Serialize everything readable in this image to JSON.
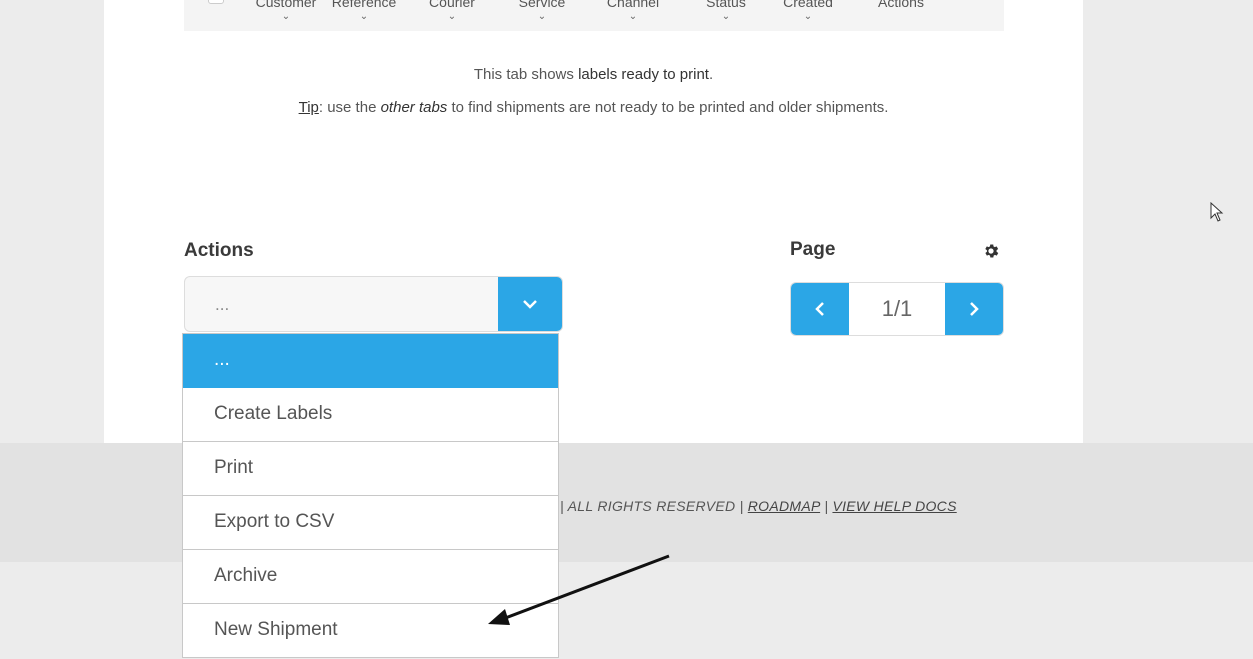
{
  "table": {
    "columns": [
      "Customer",
      "Reference",
      "Courier",
      "Service",
      "Channel",
      "Status",
      "Created",
      "Actions"
    ]
  },
  "tip": {
    "line1_pre": "This tab shows ",
    "line1_bold": "labels ready to print",
    "line1_post": ".",
    "tip_label": "Tip",
    "line2_pre": ": use the ",
    "line2_italic": "other tabs",
    "line2_post": " to find shipments are not ready to be printed and older shipments."
  },
  "actions": {
    "title": "Actions",
    "selected_value": "...",
    "options": [
      "...",
      "Create Labels",
      "Print",
      "Export to CSV",
      "Archive",
      "New Shipment"
    ]
  },
  "pager": {
    "title": "Page",
    "label": "1/1"
  },
  "footer": {
    "rights": "| ALL RIGHTS RESERVED |",
    "roadmap": "ROADMAP",
    "sep": "|",
    "help": "VIEW HELP DOCS"
  },
  "icons": {
    "settings": "gear-icon",
    "prev": "chevron-left-icon",
    "next": "chevron-right-icon",
    "dropdown": "chevron-down-icon"
  },
  "colors": {
    "accent": "#2ba6e6"
  }
}
